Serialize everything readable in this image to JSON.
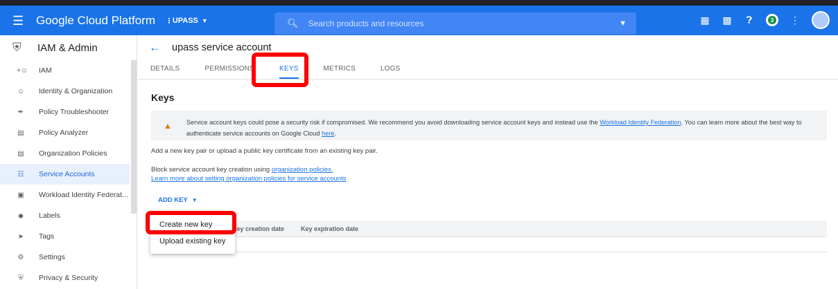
{
  "topbar": {
    "brand": "Google Cloud Platform",
    "project": "UPASS",
    "search_placeholder": "Search products and resources",
    "notification_count": "3"
  },
  "sidebar": {
    "title": "IAM & Admin",
    "items": [
      {
        "label": "IAM",
        "icon": "person-add-icon"
      },
      {
        "label": "Identity & Organization",
        "icon": "account-circle-icon"
      },
      {
        "label": "Policy Troubleshooter",
        "icon": "wrench-icon"
      },
      {
        "label": "Policy Analyzer",
        "icon": "document-search-icon"
      },
      {
        "label": "Organization Policies",
        "icon": "list-icon"
      },
      {
        "label": "Service Accounts",
        "icon": "service-account-icon"
      },
      {
        "label": "Workload Identity Federat...",
        "icon": "id-card-icon"
      },
      {
        "label": "Labels",
        "icon": "label-icon"
      },
      {
        "label": "Tags",
        "icon": "tag-icon"
      },
      {
        "label": "Settings",
        "icon": "gear-icon"
      },
      {
        "label": "Privacy & Security",
        "icon": "shield-icon"
      }
    ],
    "active_item": "Service Accounts"
  },
  "main": {
    "page_title": "upass service account",
    "tabs": [
      "DETAILS",
      "PERMISSIONS",
      "KEYS",
      "METRICS",
      "LOGS"
    ],
    "active_tab": "KEYS",
    "section_title": "Keys",
    "warning": {
      "text_before": "Service account keys could pose a security risk if compromised. We recommend you avoid downloading service account keys and instead use the",
      "link1": "Workload Identity Federation",
      "text_middle": ". You can learn more about the best way to authenticate service accounts on Google Cloud",
      "link2": "here",
      "text_after": "."
    },
    "intro": "Add a new key pair or upload a public key certificate from an existing key pair.",
    "block_text": "Block service account key creation using",
    "block_link": "organization policies.",
    "learn_link": "Learn more about setting organization policies for service accounts",
    "add_key_label": "ADD KEY",
    "table_headers": [
      "Key creation date",
      "Key expiration date"
    ],
    "dropdown": [
      "Create new key",
      "Upload existing key"
    ]
  },
  "colors": {
    "primary": "#1a73e8",
    "highlight": "#ff0000",
    "warning": "#e37400"
  }
}
